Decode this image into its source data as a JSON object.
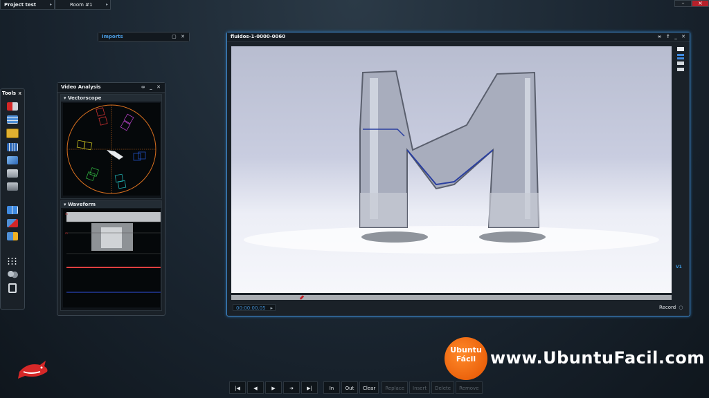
{
  "top_tabs": [
    {
      "label": "Project test"
    },
    {
      "label": "Room #1"
    }
  ],
  "imports_panel": {
    "title": "Imports"
  },
  "tools_panel": {
    "title": "Tools",
    "close": "x"
  },
  "video_analysis": {
    "title": "Video Analysis",
    "vectorscope_title": "Vectorscope",
    "waveform_title": "Waveform"
  },
  "viewer": {
    "title": "fluidos-1-0000-0060",
    "timecode": "00:00:00.05",
    "record_label": "Record",
    "layer_label": "V1",
    "progress": 0.16
  },
  "transport": {
    "buttons": [
      "|◀",
      "◀",
      "▶",
      "➔",
      "▶|",
      "In",
      "Out",
      "Clear",
      "Replace",
      "Insert",
      "Delete",
      "Remove"
    ]
  },
  "watermark": {
    "logo_line1": "Ubuntu",
    "logo_line2": "Fácil",
    "url": "www.UbuntuFacil.com"
  }
}
